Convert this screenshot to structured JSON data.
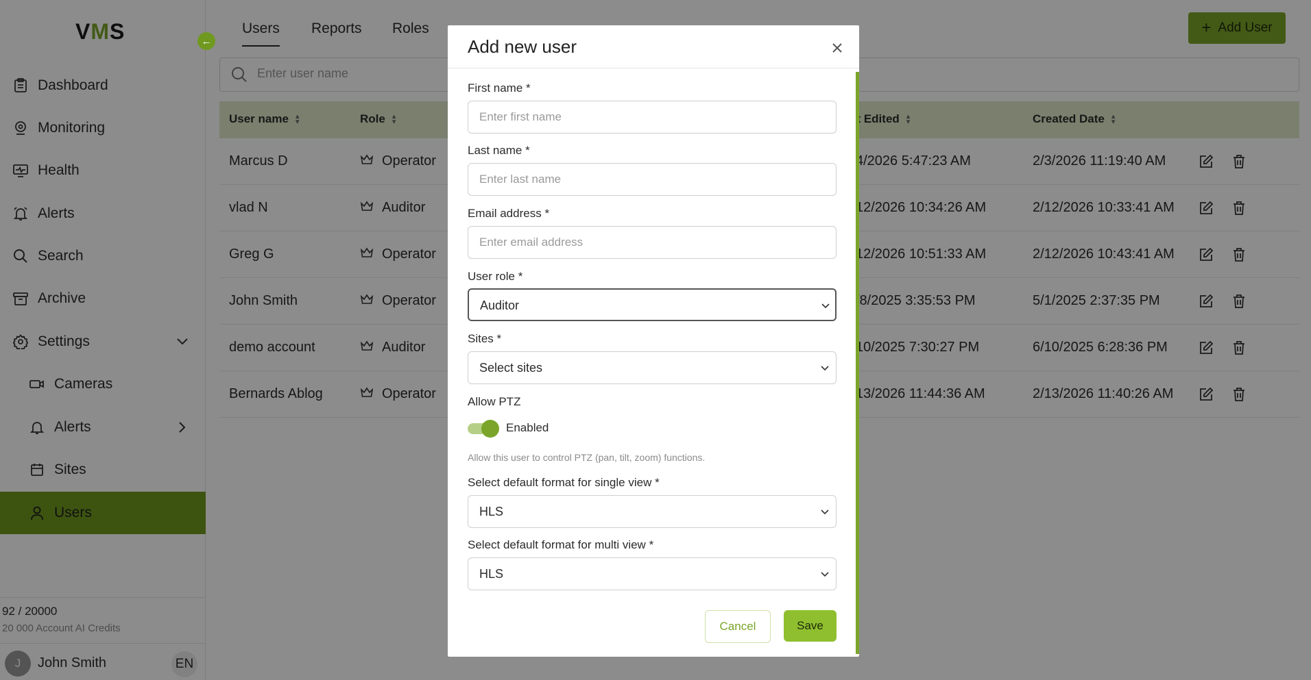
{
  "app": {
    "logo_prefix": "V",
    "logo_accent": "M",
    "logo_suffix": "S",
    "accent_color": "#7aa52a"
  },
  "sidebar": {
    "items": [
      {
        "label": "Dashboard",
        "icon": "dashboard-icon"
      },
      {
        "label": "Monitoring",
        "icon": "monitoring-icon"
      },
      {
        "label": "Health",
        "icon": "health-icon"
      },
      {
        "label": "Alerts",
        "icon": "bell-icon"
      },
      {
        "label": "Search",
        "icon": "search-icon"
      },
      {
        "label": "Archive",
        "icon": "archive-icon"
      },
      {
        "label": "Settings",
        "icon": "gear-icon"
      }
    ],
    "settings_sub": [
      {
        "label": "Cameras",
        "icon": "camera-icon"
      },
      {
        "label": "Alerts",
        "icon": "bell-icon"
      },
      {
        "label": "Sites",
        "icon": "calendar-icon"
      },
      {
        "label": "Users",
        "icon": "user-icon",
        "active": true
      }
    ],
    "credits": {
      "usage": "92 / 20000",
      "caption": "20 000 Account AI Credits"
    },
    "user": {
      "initial": "J",
      "name": "John Smith",
      "language": "EN"
    }
  },
  "tabs": [
    {
      "label": "Users",
      "active": true
    },
    {
      "label": "Reports"
    },
    {
      "label": "Roles"
    }
  ],
  "toolbar": {
    "add_user_label": "Add User",
    "search_placeholder": "Enter user name"
  },
  "table": {
    "columns": [
      "User name",
      "Role",
      "st Edited",
      "Created Date"
    ],
    "rows": [
      {
        "name": "Marcus D",
        "role": "Operator",
        "last_edited": "4/2026 5:47:23 AM",
        "created": "2/3/2026 11:19:40 AM"
      },
      {
        "name": "vlad N",
        "role": "Auditor",
        "last_edited": "12/2026 10:34:26 AM",
        "created": "2/12/2026 10:33:41 AM"
      },
      {
        "name": "Greg G",
        "role": "Operator",
        "last_edited": "12/2026 10:51:33 AM",
        "created": "2/12/2026 10:43:41 AM"
      },
      {
        "name": "John Smith",
        "role": "Operator",
        "last_edited": "/8/2025 3:35:53 PM",
        "created": "5/1/2025 2:37:35 PM"
      },
      {
        "name": "demo account",
        "role": "Auditor",
        "last_edited": "10/2025 7:30:27 PM",
        "created": "6/10/2025 6:28:36 PM"
      },
      {
        "name": "Bernards Ablog",
        "role": "Operator",
        "last_edited": "13/2026 11:44:36 AM",
        "created": "2/13/2026 11:40:26 AM"
      }
    ]
  },
  "modal": {
    "title": "Add new user",
    "first_name": {
      "label": "First name",
      "placeholder": "Enter first name"
    },
    "last_name": {
      "label": "Last name",
      "placeholder": "Enter last name"
    },
    "email": {
      "label": "Email address",
      "placeholder": "Enter email address"
    },
    "user_role": {
      "label": "User role",
      "value": "Auditor"
    },
    "sites": {
      "label": "Sites",
      "value": "Select sites"
    },
    "ptz": {
      "label": "Allow PTZ",
      "toggle_label": "Enabled",
      "enabled": true,
      "help": "Allow this user to control PTZ (pan, tilt, zoom) functions."
    },
    "single_view": {
      "label": "Select default format for single view",
      "value": "HLS"
    },
    "multi_view": {
      "label": "Select default format for multi view",
      "value": "HLS"
    },
    "required_mark": "*",
    "cancel_label": "Cancel",
    "save_label": "Save"
  }
}
